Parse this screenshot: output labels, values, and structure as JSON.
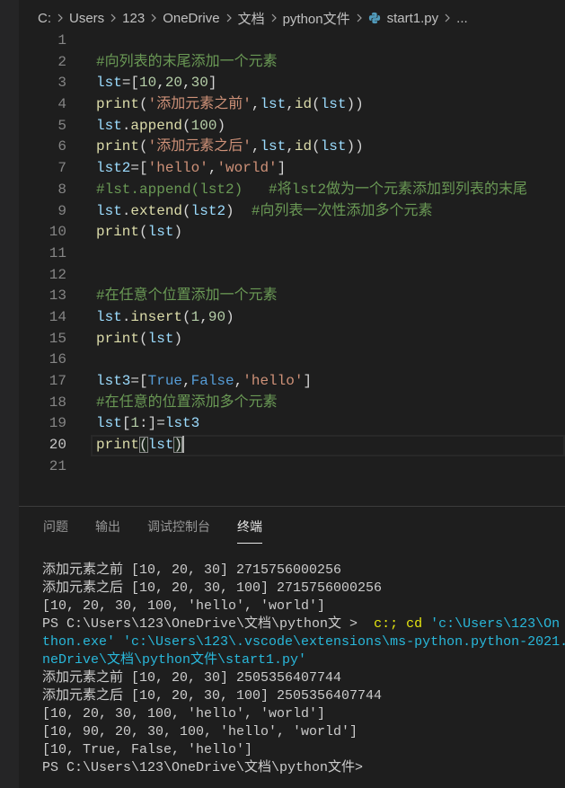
{
  "theme": {
    "editor_bg": "#1e1e1e",
    "sidebar_bg": "#252526",
    "breadcrumb_fg": "#c0c0c0",
    "line_number": "#858585",
    "active_line_number": "#c6c6c6",
    "current_line_border": "#282828",
    "cursor": "#aeafad",
    "panel_border": "#3c3c3c",
    "tab_inactive": "#969696",
    "tab_active": "#e7e7e7"
  },
  "breadcrumb": {
    "items": [
      "C:",
      "Users",
      "123",
      "OneDrive",
      "文档",
      "python文件",
      "start1.py",
      "..."
    ],
    "separator_icon": "chevron-right-icon",
    "file_icon": "python-file-icon"
  },
  "editor": {
    "lines": [
      {
        "number": "1",
        "tokens": []
      },
      {
        "number": "2",
        "tokens": [
          {
            "text": "#向列表的末尾添加一个元素",
            "color": "#6a9955"
          }
        ]
      },
      {
        "number": "3",
        "tokens": [
          {
            "text": "lst",
            "color": "#9cdcfe"
          },
          {
            "text": "=[",
            "color": "#d4d4d4"
          },
          {
            "text": "10",
            "color": "#b5cea8"
          },
          {
            "text": ",",
            "color": "#d4d4d4"
          },
          {
            "text": "20",
            "color": "#b5cea8"
          },
          {
            "text": ",",
            "color": "#d4d4d4"
          },
          {
            "text": "30",
            "color": "#b5cea8"
          },
          {
            "text": "]",
            "color": "#d4d4d4"
          }
        ]
      },
      {
        "number": "4",
        "tokens": [
          {
            "text": "print",
            "color": "#dcdcaa"
          },
          {
            "text": "(",
            "color": "#d4d4d4"
          },
          {
            "text": "'添加元素之前'",
            "color": "#ce9178"
          },
          {
            "text": ",",
            "color": "#d4d4d4"
          },
          {
            "text": "lst",
            "color": "#9cdcfe"
          },
          {
            "text": ",",
            "color": "#d4d4d4"
          },
          {
            "text": "id",
            "color": "#dcdcaa"
          },
          {
            "text": "(",
            "color": "#d4d4d4"
          },
          {
            "text": "lst",
            "color": "#9cdcfe"
          },
          {
            "text": "))",
            "color": "#d4d4d4"
          }
        ]
      },
      {
        "number": "5",
        "tokens": [
          {
            "text": "lst",
            "color": "#9cdcfe"
          },
          {
            "text": ".",
            "color": "#d4d4d4"
          },
          {
            "text": "append",
            "color": "#dcdcaa"
          },
          {
            "text": "(",
            "color": "#d4d4d4"
          },
          {
            "text": "100",
            "color": "#b5cea8"
          },
          {
            "text": ")",
            "color": "#d4d4d4"
          }
        ]
      },
      {
        "number": "6",
        "tokens": [
          {
            "text": "print",
            "color": "#dcdcaa"
          },
          {
            "text": "(",
            "color": "#d4d4d4"
          },
          {
            "text": "'添加元素之后'",
            "color": "#ce9178"
          },
          {
            "text": ",",
            "color": "#d4d4d4"
          },
          {
            "text": "lst",
            "color": "#9cdcfe"
          },
          {
            "text": ",",
            "color": "#d4d4d4"
          },
          {
            "text": "id",
            "color": "#dcdcaa"
          },
          {
            "text": "(",
            "color": "#d4d4d4"
          },
          {
            "text": "lst",
            "color": "#9cdcfe"
          },
          {
            "text": "))",
            "color": "#d4d4d4"
          }
        ]
      },
      {
        "number": "7",
        "tokens": [
          {
            "text": "lst2",
            "color": "#9cdcfe"
          },
          {
            "text": "=[",
            "color": "#d4d4d4"
          },
          {
            "text": "'hello'",
            "color": "#ce9178"
          },
          {
            "text": ",",
            "color": "#d4d4d4"
          },
          {
            "text": "'world'",
            "color": "#ce9178"
          },
          {
            "text": "]",
            "color": "#d4d4d4"
          }
        ]
      },
      {
        "number": "8",
        "tokens": [
          {
            "text": "#lst.append(lst2)   #将lst2做为一个元素添加到列表的末尾",
            "color": "#6a9955"
          }
        ]
      },
      {
        "number": "9",
        "tokens": [
          {
            "text": "lst",
            "color": "#9cdcfe"
          },
          {
            "text": ".",
            "color": "#d4d4d4"
          },
          {
            "text": "extend",
            "color": "#dcdcaa"
          },
          {
            "text": "(",
            "color": "#d4d4d4"
          },
          {
            "text": "lst2",
            "color": "#9cdcfe"
          },
          {
            "text": ")  ",
            "color": "#d4d4d4"
          },
          {
            "text": "#向列表一次性添加多个元素",
            "color": "#6a9955"
          }
        ]
      },
      {
        "number": "10",
        "tokens": [
          {
            "text": "print",
            "color": "#dcdcaa"
          },
          {
            "text": "(",
            "color": "#d4d4d4"
          },
          {
            "text": "lst",
            "color": "#9cdcfe"
          },
          {
            "text": ")",
            "color": "#d4d4d4"
          }
        ]
      },
      {
        "number": "11",
        "tokens": []
      },
      {
        "number": "12",
        "tokens": []
      },
      {
        "number": "13",
        "tokens": [
          {
            "text": "#在任意个位置添加一个元素",
            "color": "#6a9955"
          }
        ]
      },
      {
        "number": "14",
        "tokens": [
          {
            "text": "lst",
            "color": "#9cdcfe"
          },
          {
            "text": ".",
            "color": "#d4d4d4"
          },
          {
            "text": "insert",
            "color": "#dcdcaa"
          },
          {
            "text": "(",
            "color": "#d4d4d4"
          },
          {
            "text": "1",
            "color": "#b5cea8"
          },
          {
            "text": ",",
            "color": "#d4d4d4"
          },
          {
            "text": "90",
            "color": "#b5cea8"
          },
          {
            "text": ")",
            "color": "#d4d4d4"
          }
        ]
      },
      {
        "number": "15",
        "tokens": [
          {
            "text": "print",
            "color": "#dcdcaa"
          },
          {
            "text": "(",
            "color": "#d4d4d4"
          },
          {
            "text": "lst",
            "color": "#9cdcfe"
          },
          {
            "text": ")",
            "color": "#d4d4d4"
          }
        ]
      },
      {
        "number": "16",
        "tokens": []
      },
      {
        "number": "17",
        "tokens": [
          {
            "text": "lst3",
            "color": "#9cdcfe"
          },
          {
            "text": "=[",
            "color": "#d4d4d4"
          },
          {
            "text": "True",
            "color": "#569cd6"
          },
          {
            "text": ",",
            "color": "#d4d4d4"
          },
          {
            "text": "False",
            "color": "#569cd6"
          },
          {
            "text": ",",
            "color": "#d4d4d4"
          },
          {
            "text": "'hello'",
            "color": "#ce9178"
          },
          {
            "text": "]",
            "color": "#d4d4d4"
          }
        ]
      },
      {
        "number": "18",
        "tokens": [
          {
            "text": "#在任意的位置添加多个元素",
            "color": "#6a9955"
          }
        ]
      },
      {
        "number": "19",
        "tokens": [
          {
            "text": "lst",
            "color": "#9cdcfe"
          },
          {
            "text": "[",
            "color": "#d4d4d4"
          },
          {
            "text": "1",
            "color": "#b5cea8"
          },
          {
            "text": ":]=",
            "color": "#d4d4d4"
          },
          {
            "text": "lst3",
            "color": "#9cdcfe"
          }
        ]
      },
      {
        "number": "20",
        "active": true,
        "tokens": [
          {
            "text": "print",
            "color": "#dcdcaa"
          },
          {
            "text": "(",
            "color": "#d4d4d4",
            "match": true
          },
          {
            "text": "lst",
            "color": "#9cdcfe"
          },
          {
            "text": ")",
            "color": "#d4d4d4",
            "match": true
          }
        ]
      },
      {
        "number": "21",
        "tokens": []
      }
    ]
  },
  "panel": {
    "tabs": [
      {
        "label": "问题"
      },
      {
        "label": "输出"
      },
      {
        "label": "调试控制台"
      },
      {
        "label": "终端",
        "active": true
      }
    ],
    "terminal": {
      "lines": [
        [
          {
            "text": "添加元素之前 [10, 20, 30] 2715756000256",
            "color": "#cccccc"
          }
        ],
        [
          {
            "text": "添加元素之后 [10, 20, 30, 100] 2715756000256",
            "color": "#cccccc"
          }
        ],
        [
          {
            "text": "[10, 20, 30, 100, 'hello', 'world']",
            "color": "#cccccc"
          }
        ],
        [
          {
            "text": "PS C:\\Users\\123\\OneDrive\\文档\\python文 >  ",
            "color": "#cccccc"
          },
          {
            "text": "c:; cd ",
            "color": "#e5e510"
          },
          {
            "text": "'c:\\Users\\123\\On",
            "color": "#29b8db"
          }
        ],
        [
          {
            "text": "thon.exe' 'c:\\Users\\123\\.vscode\\extensions\\ms-python.python-2021.",
            "color": "#29b8db"
          }
        ],
        [
          {
            "text": "neDrive\\文档\\python文件\\start1.py'",
            "color": "#29b8db"
          }
        ],
        [
          {
            "text": "添加元素之前 [10, 20, 30] 2505356407744",
            "color": "#cccccc"
          }
        ],
        [
          {
            "text": "添加元素之后 [10, 20, 30, 100] 2505356407744",
            "color": "#cccccc"
          }
        ],
        [
          {
            "text": "[10, 20, 30, 100, 'hello', 'world']",
            "color": "#cccccc"
          }
        ],
        [
          {
            "text": "[10, 90, 20, 30, 100, 'hello', 'world']",
            "color": "#cccccc"
          }
        ],
        [
          {
            "text": "[10, True, False, 'hello']",
            "color": "#cccccc"
          }
        ],
        [
          {
            "text": "PS C:\\Users\\123\\OneDrive\\文档\\python文件>",
            "color": "#cccccc"
          }
        ]
      ]
    }
  }
}
